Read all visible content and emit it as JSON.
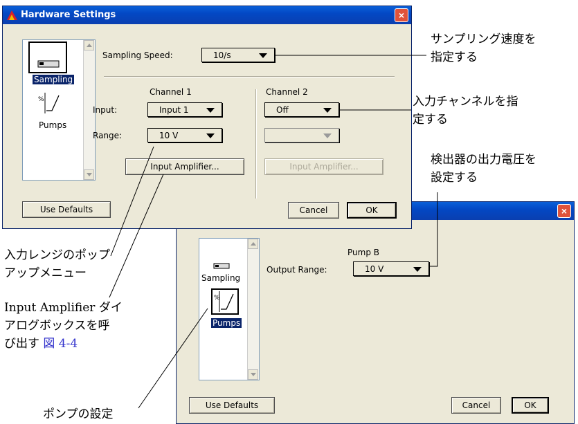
{
  "front_window": {
    "title": "Hardware Settings",
    "close": "×",
    "sidebar": [
      {
        "label": "Sampling",
        "selected": true,
        "icon": "sampling-card-icon"
      },
      {
        "label": "Pumps",
        "selected": false,
        "icon": "pump-curve-icon"
      }
    ],
    "sampling_speed_label": "Sampling Speed:",
    "sampling_speed_value": "10/s",
    "channel1_title": "Channel 1",
    "channel2_title": "Channel 2",
    "input_label": "Input:",
    "range_label": "Range:",
    "ch1_input": "Input 1",
    "ch1_range": "10 V",
    "ch2_input": "Off",
    "ch2_range": "",
    "ch1_amp_button": "Input Amplifier...",
    "ch2_amp_button": "Input Amplifier...",
    "use_defaults": "Use Defaults",
    "cancel": "Cancel",
    "ok": "OK"
  },
  "back_window": {
    "close": "×",
    "sidebar": [
      {
        "label": "Sampling",
        "selected": false,
        "icon": "sampling-card-icon"
      },
      {
        "label": "Pumps",
        "selected": true,
        "icon": "pump-curve-icon"
      }
    ],
    "pump_title": "Pump B",
    "output_range_label": "Output Range:",
    "output_range_value": "10 V",
    "use_defaults": "Use Defaults",
    "cancel": "Cancel",
    "ok": "OK"
  },
  "annotations": {
    "sampling_speed_1": "サンプリング速度を",
    "sampling_speed_2": "指定する",
    "input_channel_1": "入力チャンネルを指",
    "input_channel_2": "定する",
    "detector_1": "検出器の出力電圧を",
    "detector_2": "設定する",
    "range_popup_1": "入力レンジのポップ",
    "range_popup_2": "アップメニュー",
    "amp_1": "Input Amplifier ダイ",
    "amp_2": "アログボックスを呼",
    "amp_3": "び出す",
    "amp_link": "図 4-4",
    "pump_setting": "ポンプの設定"
  },
  "colors": {
    "titlebar": "#0348c4",
    "close": "#e0533b",
    "dialog_bg": "#ece9d8",
    "selection": "#0a246a",
    "link": "#3333cc"
  }
}
